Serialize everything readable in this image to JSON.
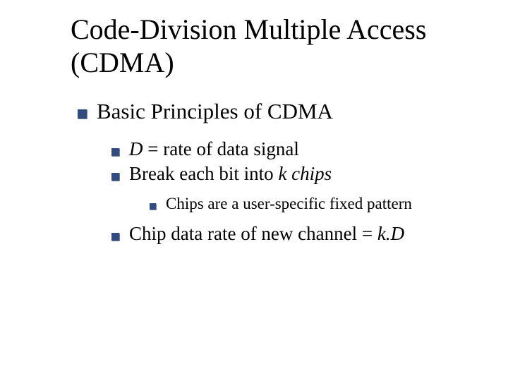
{
  "title": "Code-Division Multiple Access (CDMA)",
  "lvl1": {
    "text": "Basic Principles of CDMA"
  },
  "lvl2a": {
    "pre": "D",
    "post": " = rate of data signal"
  },
  "lvl2b": {
    "pre": "Break each bit into ",
    "post": "k chips"
  },
  "lvl3": {
    "text": "Chips are a user-specific fixed pattern"
  },
  "lvl2c": {
    "pre": "Chip data rate of new channel = ",
    "post": "k.D"
  }
}
